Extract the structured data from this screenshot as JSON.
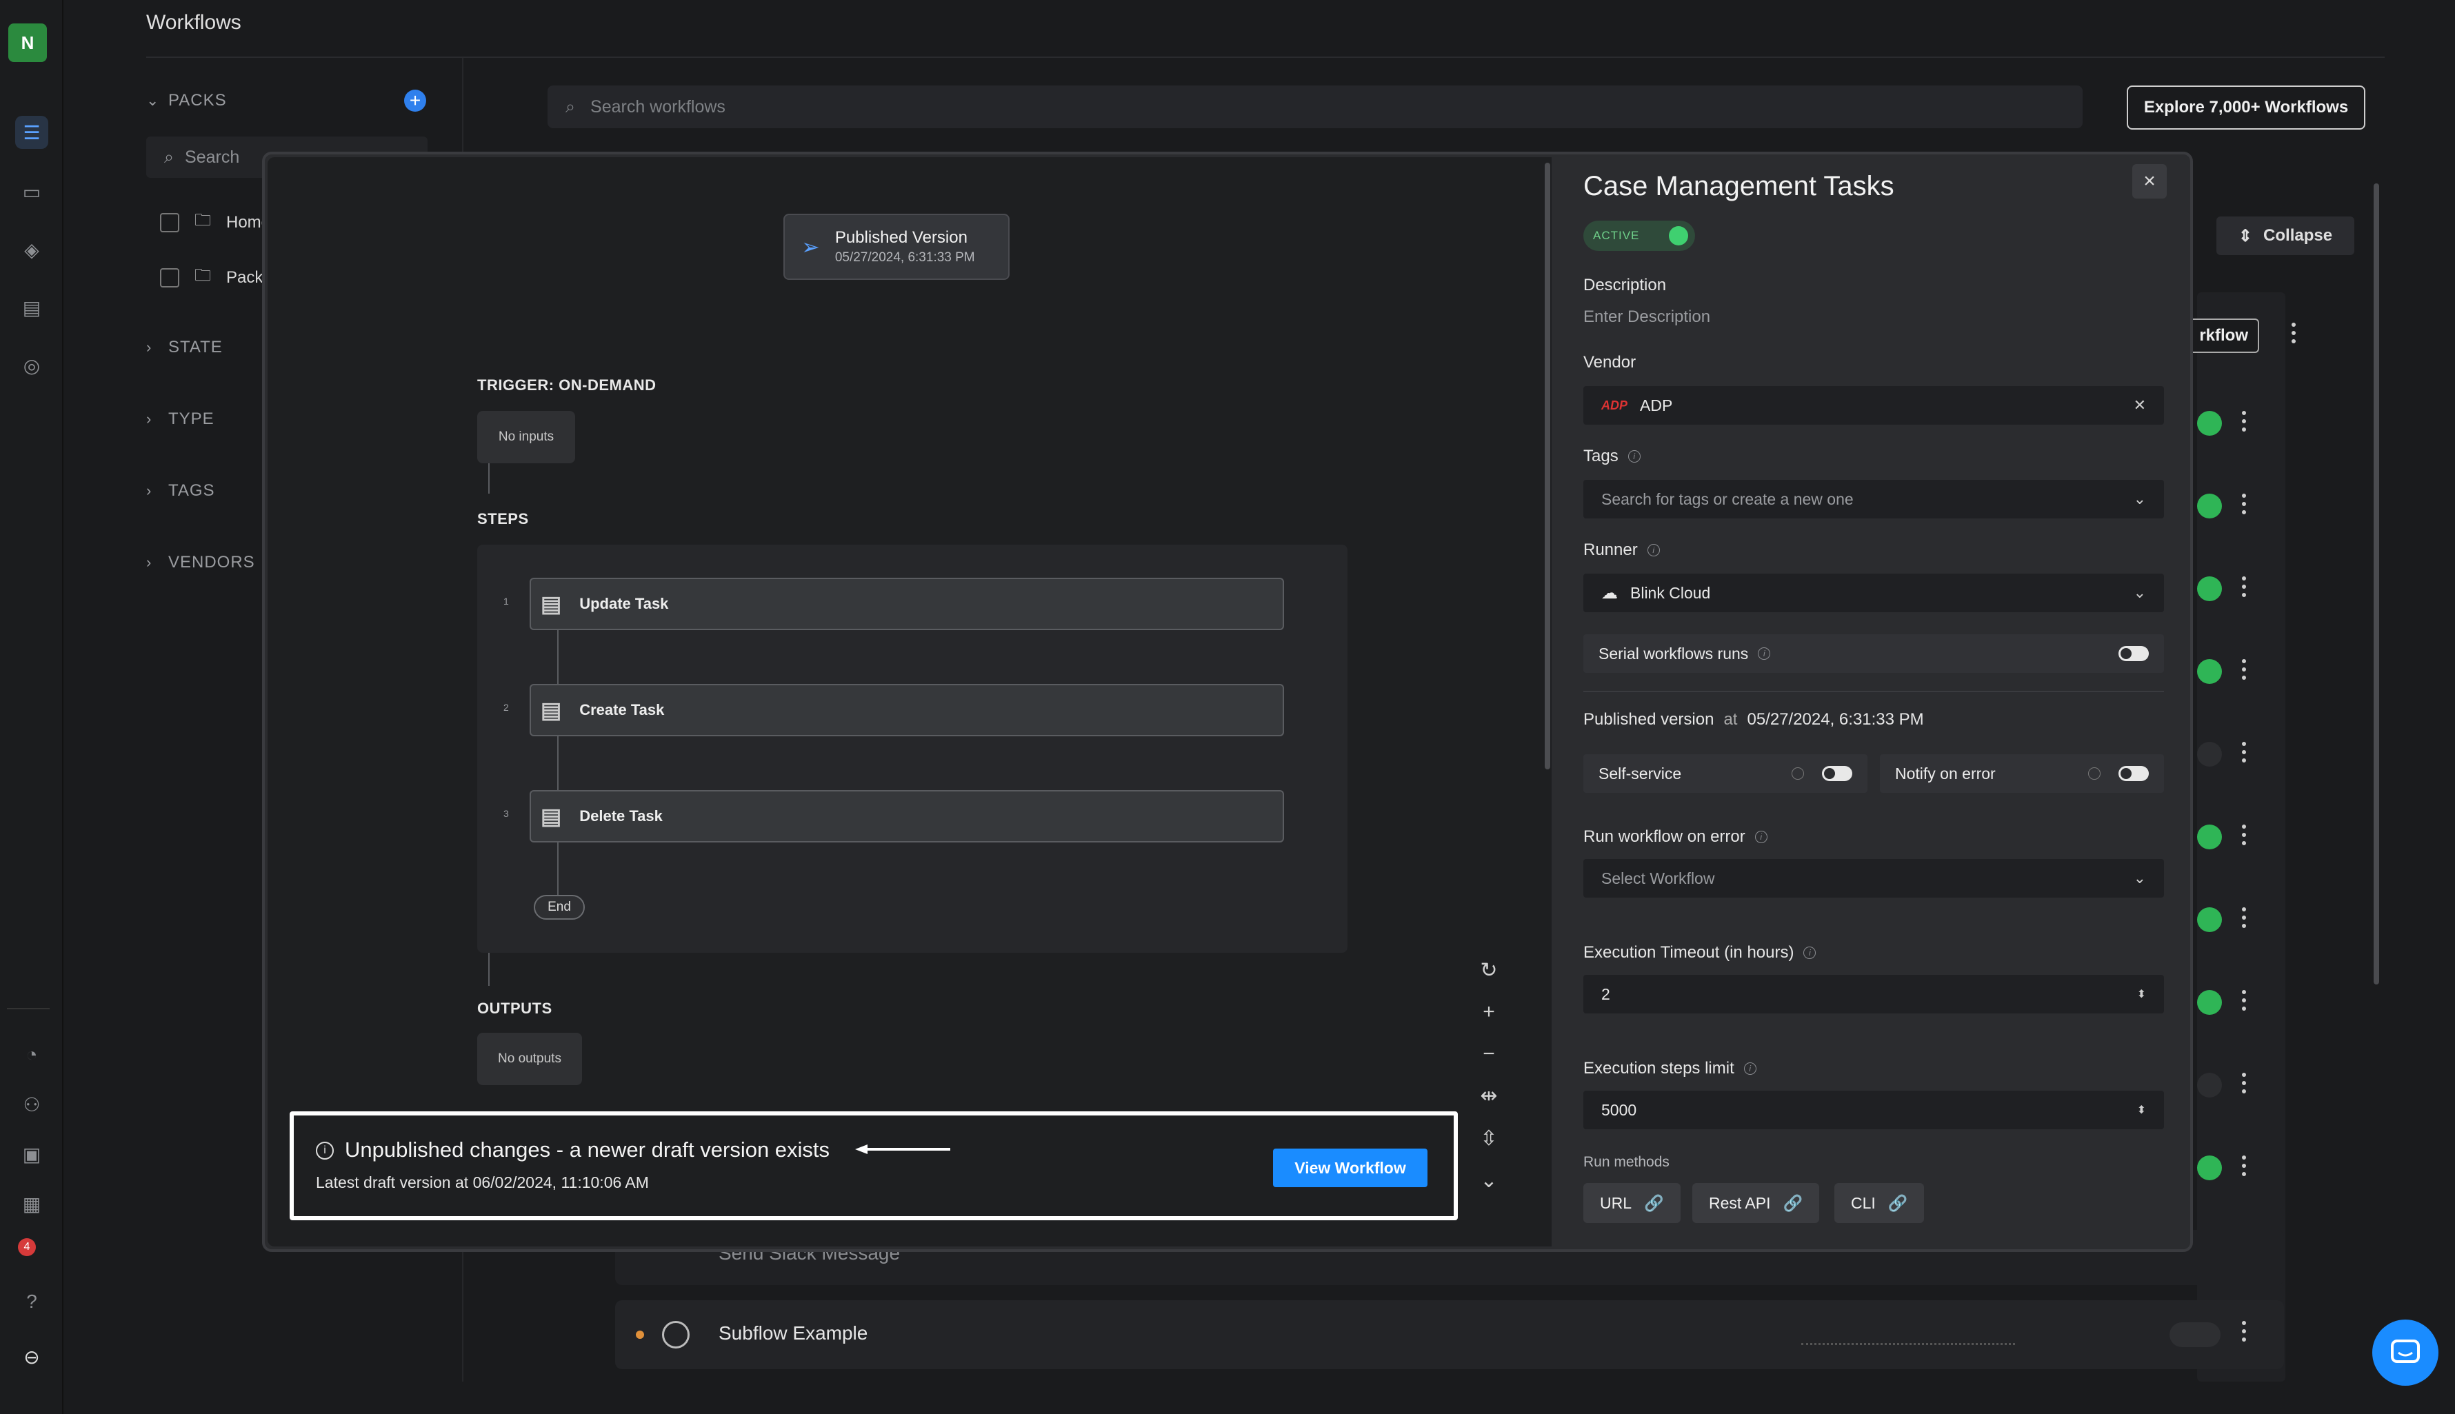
{
  "app": {
    "logo_letter": "N",
    "page_title": "Workflows"
  },
  "rail": {
    "icons": [
      "workflows-icon",
      "calendar-icon",
      "layers-icon",
      "tasks-icon",
      "settings-icon",
      "analytics-icon",
      "users-icon",
      "cases-icon",
      "reports-icon",
      "notifications-icon",
      "help-icon",
      "assistant-icon"
    ],
    "notification_count": "4"
  },
  "packs": {
    "header": "PACKS",
    "search_placeholder": "Search",
    "items": [
      "Home",
      "Pack"
    ],
    "sections": [
      "STATE",
      "TYPE",
      "TAGS",
      "VENDORS"
    ]
  },
  "main": {
    "search_placeholder": "Search workflows",
    "explore_label": "Explore 7,000+ Workflows",
    "collapse_label": "Collapse",
    "workflow_btn_partial": "rkflow",
    "partial_row_text": "Send Slack Message",
    "last_row_text": "Subflow Example"
  },
  "canvas": {
    "published_title": "Published Version",
    "published_date": "05/27/2024, 6:31:33 PM",
    "trigger_label": "TRIGGER: ON-DEMAND",
    "no_inputs": "No inputs",
    "steps_label": "STEPS",
    "steps": [
      {
        "num": "1",
        "label": "Update Task"
      },
      {
        "num": "2",
        "label": "Create Task"
      },
      {
        "num": "3",
        "label": "Delete Task"
      }
    ],
    "end_label": "End",
    "outputs_label": "OUTPUTS",
    "no_outputs": "No outputs"
  },
  "banner": {
    "title": "Unpublished changes - a newer draft version exists",
    "subtitle": "Latest draft version at 06/02/2024, 11:10:06 AM",
    "button": "View Workflow"
  },
  "panel": {
    "title": "Case Management Tasks",
    "active_label": "ACTIVE",
    "description_label": "Description",
    "description_placeholder": "Enter Description",
    "vendor_label": "Vendor",
    "vendor_value": "ADP",
    "tags_label": "Tags",
    "tags_placeholder": "Search for tags or create a new one",
    "runner_label": "Runner",
    "runner_value": "Blink Cloud",
    "serial_label": "Serial workflows runs",
    "published_label": "Published version",
    "published_at": "at",
    "published_date": "05/27/2024, 6:31:33 PM",
    "self_service_label": "Self-service",
    "notify_label": "Notify on error",
    "run_on_error_label": "Run workflow on error",
    "run_on_error_placeholder": "Select Workflow",
    "timeout_label": "Execution Timeout (in hours)",
    "timeout_value": "2",
    "steps_limit_label": "Execution steps limit",
    "steps_limit_value": "5000",
    "run_methods_label": "Run methods",
    "run_methods": [
      "URL",
      "Rest API",
      "CLI"
    ]
  },
  "colors": {
    "accent": "#1a8cff",
    "active_green": "#3fd070",
    "banner_border": "#ffffff",
    "background": "#1a1b1d"
  }
}
